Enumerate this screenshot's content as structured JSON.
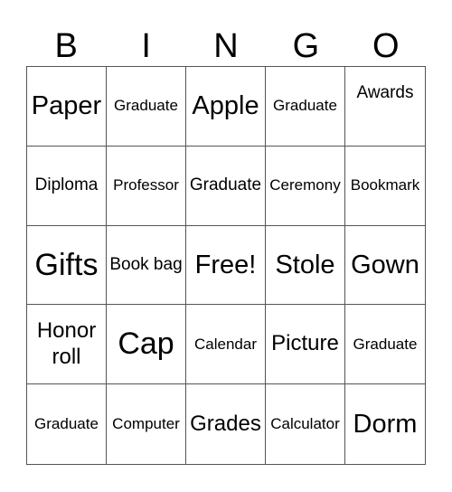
{
  "header": [
    "B",
    "I",
    "N",
    "G",
    "O"
  ],
  "cells": [
    {
      "text": "Paper",
      "size": "s4"
    },
    {
      "text": "Graduate",
      "size": "s1"
    },
    {
      "text": "Apple",
      "size": "s4"
    },
    {
      "text": "Graduate",
      "size": "s1"
    },
    {
      "text": "Awards",
      "size": "s2 top"
    },
    {
      "text": "Diploma",
      "size": "s2"
    },
    {
      "text": "Professor",
      "size": "s1"
    },
    {
      "text": "Graduate",
      "size": "s2"
    },
    {
      "text": "Ceremony",
      "size": "s1"
    },
    {
      "text": "Bookmark",
      "size": "s1"
    },
    {
      "text": "Gifts",
      "size": "s5"
    },
    {
      "text": "Book bag",
      "size": "s2"
    },
    {
      "text": "Free!",
      "size": "s4"
    },
    {
      "text": "Stole",
      "size": "s4"
    },
    {
      "text": "Gown",
      "size": "s4"
    },
    {
      "text": "Honor roll",
      "size": "s3"
    },
    {
      "text": "Cap",
      "size": "s5"
    },
    {
      "text": "Calendar",
      "size": "s1"
    },
    {
      "text": "Picture",
      "size": "s3"
    },
    {
      "text": "Graduate",
      "size": "s1"
    },
    {
      "text": "Graduate",
      "size": "s1"
    },
    {
      "text": "Computer",
      "size": "s1"
    },
    {
      "text": "Grades",
      "size": "s3"
    },
    {
      "text": "Calculator",
      "size": "s1"
    },
    {
      "text": "Dorm",
      "size": "s4"
    }
  ]
}
